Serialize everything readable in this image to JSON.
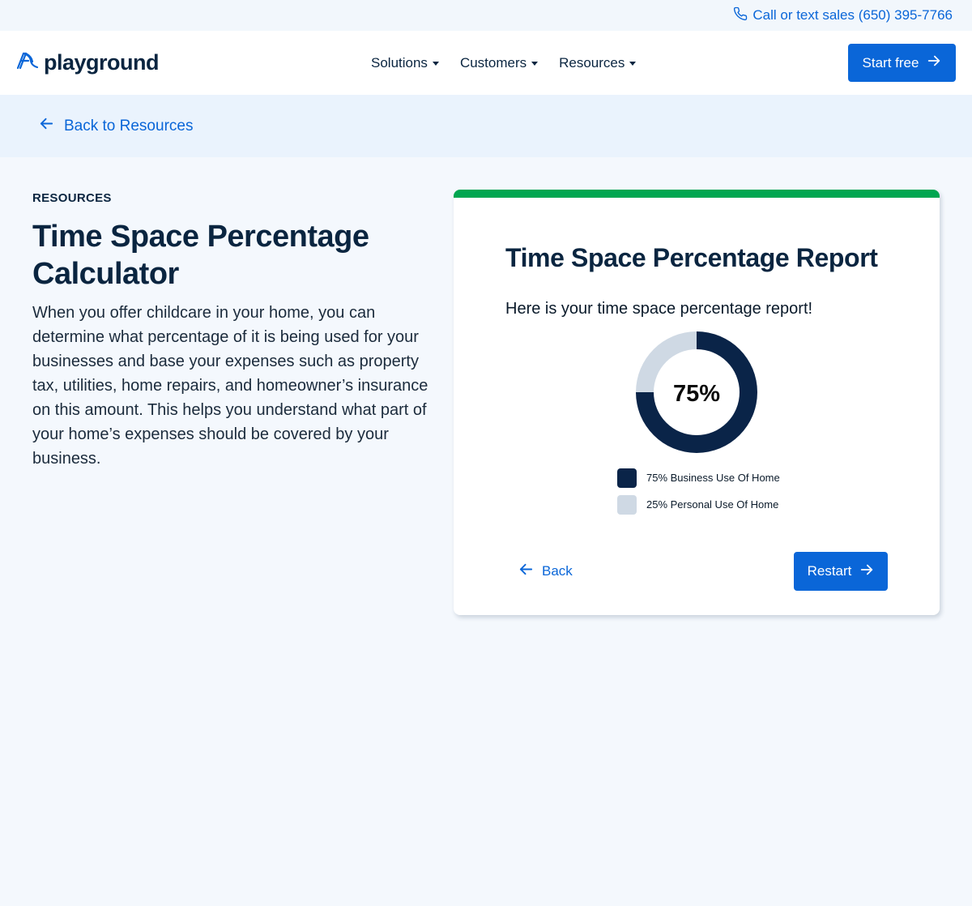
{
  "topbar": {
    "phone_label": "Call or text sales (650) 395-7766",
    "phone_icon": "phone-icon"
  },
  "nav": {
    "logo_text": "playground",
    "logo_icon": "slide-logo-icon",
    "items": [
      {
        "label": "Solutions"
      },
      {
        "label": "Customers"
      },
      {
        "label": "Resources"
      }
    ],
    "cta_label": "Start free"
  },
  "back_band": {
    "label": "Back to Resources"
  },
  "intro": {
    "eyebrow": "RESOURCES",
    "title": "Time Space Percentage Calculator",
    "description": "When you offer childcare in your home, you can determine what percentage of it is being used for your businesses and base your expenses such as property tax, utilities, home repairs, and homeowner’s insurance on this amount. This helps you understand what part of your home’s expenses should be covered by your business."
  },
  "report": {
    "title": "Time Space Percentage Report",
    "subtitle": "Here is your time space percentage report!",
    "center_label": "75%",
    "back_label": "Back",
    "restart_label": "Restart"
  },
  "chart_data": {
    "type": "pie",
    "categories": [
      "Business Use Of Home",
      "Personal Use Of Home"
    ],
    "values": [
      75,
      25
    ],
    "legend": [
      "75% Business Use Of Home",
      "25% Personal Use Of Home"
    ],
    "colors": [
      "#0a2448",
      "#cfd9e4"
    ]
  },
  "colors": {
    "primary": "#0a66d8",
    "accent_green": "#00a650",
    "navy": "#0a2540",
    "page_bg": "#f4f8fd"
  }
}
